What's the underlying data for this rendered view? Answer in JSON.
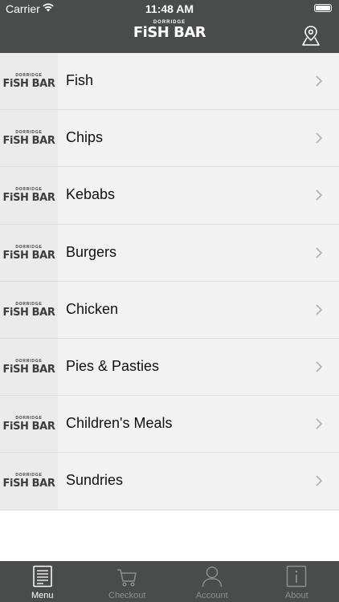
{
  "status": {
    "carrier": "Carrier",
    "time": "11:48 AM"
  },
  "header": {
    "brand_top": "DORRIDGE",
    "brand_main": "FiSH BAR"
  },
  "menu": {
    "items": [
      {
        "label": "Fish"
      },
      {
        "label": "Chips"
      },
      {
        "label": "Kebabs"
      },
      {
        "label": "Burgers"
      },
      {
        "label": "Chicken"
      },
      {
        "label": "Pies & Pasties"
      },
      {
        "label": "Children's Meals"
      },
      {
        "label": "Sundries"
      }
    ]
  },
  "tabbar": {
    "tabs": [
      {
        "label": "Menu",
        "icon": "menu-book-icon",
        "active": true
      },
      {
        "label": "Checkout",
        "icon": "cart-icon",
        "active": false
      },
      {
        "label": "Account",
        "icon": "user-icon",
        "active": false
      },
      {
        "label": "About",
        "icon": "info-icon",
        "active": false
      }
    ]
  },
  "colors": {
    "header": "#4a4b4b",
    "row": "#f2f2f2",
    "thumb": "#ebebeb",
    "tab_active": "#ffffff",
    "tab_inactive": "#8e8e8e"
  }
}
